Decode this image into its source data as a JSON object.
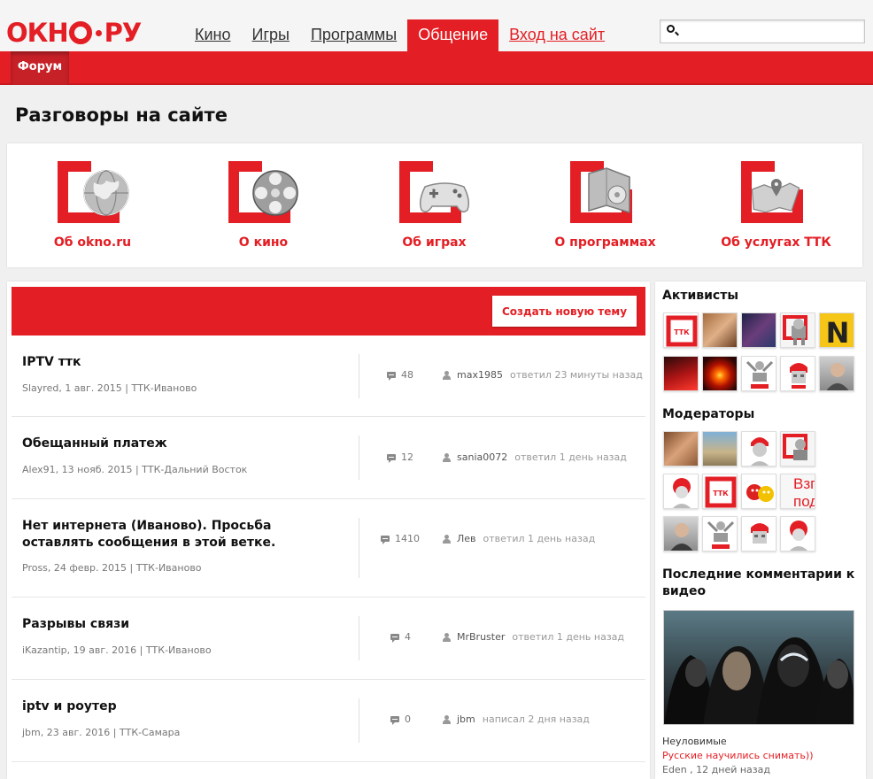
{
  "header": {
    "logo": {
      "left": "ОКН",
      "right": "РУ"
    },
    "nav": [
      {
        "label": "Кино"
      },
      {
        "label": "Игры"
      },
      {
        "label": "Программы"
      },
      {
        "label": "Общение",
        "active": true
      },
      {
        "label": "Вход на сайт"
      }
    ],
    "search": {
      "placeholder": "",
      "value": ""
    }
  },
  "subnav": {
    "tab": "Форум"
  },
  "page_title": "Разговоры на сайте",
  "categories": [
    {
      "label": "Об okno.ru",
      "icon": "globe-icon"
    },
    {
      "label": "О кино",
      "icon": "film-reel-icon"
    },
    {
      "label": "Об играх",
      "icon": "gamepad-icon"
    },
    {
      "label": "О программах",
      "icon": "software-box-icon"
    },
    {
      "label": "Об услугах ТТК",
      "icon": "map-pin-icon"
    }
  ],
  "forum": {
    "new_topic_button": "Создать новую тему",
    "threads": [
      {
        "title": "IPTV ттк",
        "meta": "Slayred, 1 авг. 2015 | ТТК-Иваново",
        "count": "48",
        "user": "max1985",
        "action": "ответил 23 минуты назад"
      },
      {
        "title": "Обещанный платеж",
        "meta": "Alex91, 13 нояб. 2015 | ТТК-Дальний Восток",
        "count": "12",
        "user": "sania0072",
        "action": "ответил 1 день назад"
      },
      {
        "title": "Нет интернета (Иваново). Просьба оставлять сообщения в этой ветке.",
        "meta": "Pross, 24 февр. 2015 | ТТК-Иваново",
        "count": "1410",
        "user": "Лев",
        "action": "ответил 1 день назад"
      },
      {
        "title": "Разрывы связи",
        "meta": "iKazantip, 19 авг. 2016 | ТТК-Иваново",
        "count": "4",
        "user": "MrBruster",
        "action": "ответил 1 день назад"
      },
      {
        "title": "iptv и роутер",
        "meta": "jbm, 23 авг. 2016 | ТТК-Самара",
        "count": "0",
        "user": "jbm",
        "action": "написал 2 дня назад"
      }
    ]
  },
  "sidebar": {
    "activists_title": "Активисты",
    "moderators_title": "Модераторы",
    "comments_title": "Последние комментарии к видео",
    "video": {
      "title": "Неуловимые",
      "comment": "Русские научились снимать))",
      "author": "Eden , 12 дней назад"
    },
    "avatar_partial_text": "Взг\nпод"
  },
  "colors": {
    "brand": "#e31e24"
  }
}
